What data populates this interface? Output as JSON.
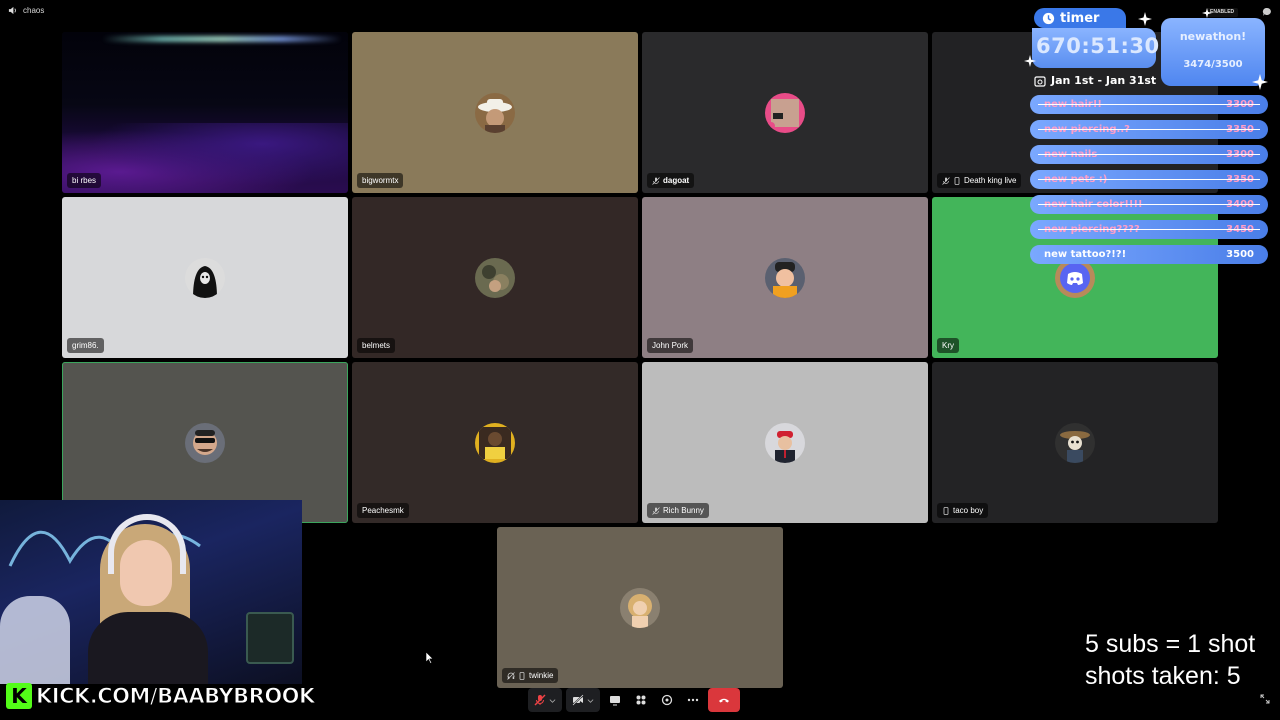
{
  "window": {
    "title": "chaos"
  },
  "participants": [
    {
      "name": "bi rbes",
      "badges": [],
      "bg": "#06060e",
      "kind": "stream"
    },
    {
      "name": "bigwormtx",
      "badges": [],
      "bg": "#8a7a5a",
      "avatar": "cowboy-hat-avatar"
    },
    {
      "name": "dagoat",
      "badges": [
        "muted-icon"
      ],
      "bg": "#2a2a2c",
      "avatar": "pink-frame-avatar",
      "bold": true
    },
    {
      "name": "Death king live",
      "badges": [
        "muted-icon",
        "mobile-icon"
      ],
      "bg": "#222224",
      "avatar": "none"
    },
    {
      "name": "grim86.",
      "badges": [],
      "bg": "#d7d8da",
      "avatar": "reaper-avatar"
    },
    {
      "name": "belmets",
      "badges": [],
      "bg": "#332826",
      "avatar": "camo-avatar"
    },
    {
      "name": "John Pork",
      "badges": [],
      "bg": "#8e7f84",
      "avatar": "pig-avatar"
    },
    {
      "name": "Kry",
      "badges": [],
      "bg": "#43b55a",
      "avatar": "discord-avatar"
    },
    {
      "name": "",
      "badges": [],
      "bg": "#54544f",
      "avatar": "sunglasses-avatar",
      "speaking": true
    },
    {
      "name": "Peachesmk",
      "badges": [],
      "bg": "#332a28",
      "avatar": "gold-avatar"
    },
    {
      "name": "Rich Bunny",
      "badges": [
        "muted-icon"
      ],
      "bg": "#bcbcbc",
      "avatar": "red-cap-avatar"
    },
    {
      "name": "taco boy",
      "badges": [
        "mobile-icon"
      ],
      "bg": "#232325",
      "avatar": "skeleton-avatar"
    },
    {
      "name": "twinkie",
      "badges": [
        "deafened-icon",
        "mobile-icon"
      ],
      "bg": "#6a6254",
      "avatar": "blonde-avatar"
    }
  ],
  "overlay": {
    "timer_label": "timer",
    "timer_value": "670:51:30",
    "goal_title": "newathon!",
    "goal_count": "3474/3500",
    "status_badge": "ENABLED",
    "date_range": "Jan 1st - Jan 31st",
    "goals": [
      {
        "label": "new hair!!",
        "value": "3300",
        "done": true
      },
      {
        "label": "new piercing..?",
        "value": "3350",
        "done": true
      },
      {
        "label": "new nails",
        "value": "3300",
        "done": true
      },
      {
        "label": "new pets :)",
        "value": "3350",
        "done": true
      },
      {
        "label": "new hair color!!!!",
        "value": "3400",
        "done": true
      },
      {
        "label": "new piercing????",
        "value": "3450",
        "done": true
      },
      {
        "label": "new tattoo?!?!",
        "value": "3500",
        "done": false
      }
    ],
    "subs_line1": "5 subs = 1 shot",
    "subs_line2": "shots taken: 5"
  },
  "branding": {
    "kick_letter": "K",
    "kick_url": "KICK.COM/BAABYBROOK"
  },
  "controls": [
    "mic-off-icon",
    "camera-off-icon",
    "screen-share-icon",
    "activities-icon",
    "soundboard-icon",
    "more-icon",
    "hang-up-icon"
  ],
  "colors": {
    "kick_green": "#53fc18",
    "overlay_blue": "#5a8ef0",
    "hangup_red": "#da373c",
    "speaking_green": "#3ba55d"
  }
}
